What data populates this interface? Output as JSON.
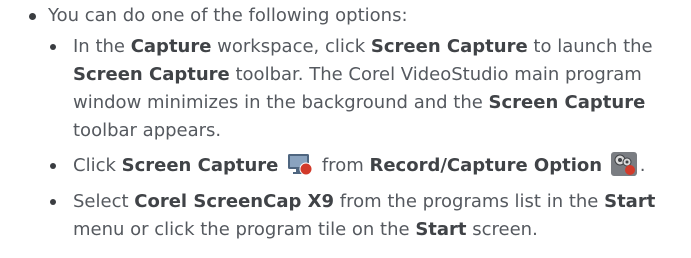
{
  "intro": "You can do one of the following options:",
  "items": [
    {
      "line1": {
        "t1": "In the ",
        "b1": "Capture",
        "t2": " workspace, click ",
        "b2": "Screen Capture",
        "t3": " to launch the"
      },
      "line2": {
        "b1": "Screen Capture",
        "t1": " toolbar. The Corel VideoStudio main program"
      },
      "line3": {
        "t1": "window minimizes in the background and the ",
        "b1": "Screen Capture"
      },
      "line4": {
        "t1": "toolbar appears."
      }
    },
    {
      "line1": {
        "t1": "Click ",
        "b1": "Screen Capture",
        "t2": " from ",
        "b2": "Record/Capture Option",
        "t3": "."
      },
      "icons": [
        "screen-capture-icon",
        "record-capture-option-icon"
      ]
    },
    {
      "line1": {
        "t1": "Select ",
        "b1": "Corel ScreenCap X9",
        "t2": " from the programs list in the ",
        "b2": "Start"
      },
      "line2": {
        "t1": "menu or click the program tile on the ",
        "b1": "Start",
        "t2": " screen."
      }
    }
  ],
  "colors": {
    "text": "#55595f",
    "bold": "#404347",
    "icon_red": "#d23a2a",
    "icon_monitor": "#5a6f86"
  }
}
